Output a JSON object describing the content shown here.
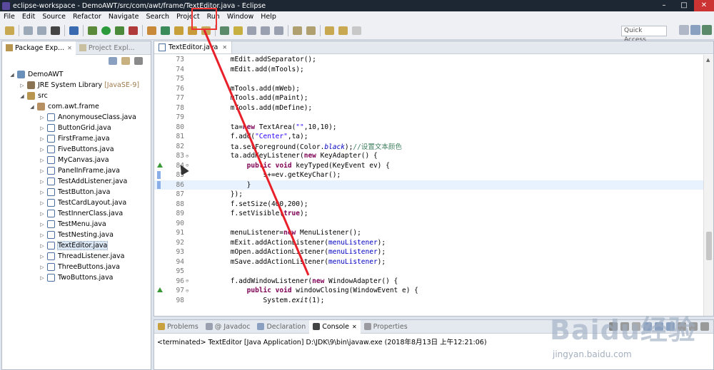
{
  "window": {
    "title": "eclipse-workspace - DemoAWT/src/com/awt/frame/TextEditor.java - Eclipse"
  },
  "menu": [
    "File",
    "Edit",
    "Source",
    "Refactor",
    "Navigate",
    "Search",
    "Project",
    "Run",
    "Window",
    "Help"
  ],
  "toolbar": {
    "quick_access": "Quick Access"
  },
  "left_panel": {
    "tabs": [
      {
        "label": "Package Exp...",
        "active": true
      },
      {
        "label": "Project Expl...",
        "active": false
      }
    ],
    "tree": [
      {
        "label": "DemoAWT",
        "level": 0,
        "expanded": true,
        "icon": "project-icon"
      },
      {
        "label": "JRE System Library",
        "version": "[JavaSE-9]",
        "level": 1,
        "expanded": false,
        "icon": "library-icon"
      },
      {
        "label": "src",
        "level": 1,
        "expanded": true,
        "icon": "source-folder-icon"
      },
      {
        "label": "com.awt.frame",
        "level": 2,
        "expanded": true,
        "icon": "package-icon"
      },
      {
        "label": "AnonymouseClass.java",
        "level": 3,
        "icon": "java-file-icon"
      },
      {
        "label": "ButtonGrid.java",
        "level": 3,
        "icon": "java-file-icon"
      },
      {
        "label": "FirstFrame.java",
        "level": 3,
        "icon": "java-file-icon"
      },
      {
        "label": "FiveButtons.java",
        "level": 3,
        "icon": "java-file-icon"
      },
      {
        "label": "MyCanvas.java",
        "level": 3,
        "icon": "java-file-icon"
      },
      {
        "label": "PanelInFrame.java",
        "level": 3,
        "icon": "java-file-icon"
      },
      {
        "label": "TestAddListener.java",
        "level": 3,
        "icon": "java-file-icon"
      },
      {
        "label": "TestButton.java",
        "level": 3,
        "icon": "java-file-icon"
      },
      {
        "label": "TestCardLayout.java",
        "level": 3,
        "icon": "java-file-icon"
      },
      {
        "label": "TestInnerClass.java",
        "level": 3,
        "icon": "java-file-icon"
      },
      {
        "label": "TestMenu.java",
        "level": 3,
        "icon": "java-file-icon"
      },
      {
        "label": "TestNesting.java",
        "level": 3,
        "icon": "java-file-icon"
      },
      {
        "label": "TextEditor.java",
        "level": 3,
        "icon": "java-file-icon",
        "selected": true
      },
      {
        "label": "ThreadListener.java",
        "level": 3,
        "icon": "java-file-icon"
      },
      {
        "label": "ThreeButtons.java",
        "level": 3,
        "icon": "java-file-icon"
      },
      {
        "label": "TwoButtons.java",
        "level": 3,
        "icon": "java-file-icon"
      }
    ]
  },
  "editor": {
    "tab_label": "TextEditor.java",
    "lines": [
      {
        "n": "73",
        "html": "        mEdit.addSeparator();"
      },
      {
        "n": "74",
        "html": "        mEdit.add(mTools);"
      },
      {
        "n": "75",
        "html": ""
      },
      {
        "n": "76",
        "html": "        mTools.add(mWeb);"
      },
      {
        "n": "77",
        "html": "        mTools.add(mPaint);"
      },
      {
        "n": "78",
        "html": "        mTools.add(mDefine);"
      },
      {
        "n": "79",
        "html": ""
      },
      {
        "n": "80",
        "html": "        ta=<span class=\"kw\">new</span> TextArea(<span class=\"str\">\"\"</span>,10,10);"
      },
      {
        "n": "81",
        "html": "        f.add(<span class=\"str\">\"Center\"</span>,ta);"
      },
      {
        "n": "82",
        "html": "        ta.setForeground(Color.<span class=\"fld it\">black</span>);<span class=\"cm\">//设置文本颜色</span>"
      },
      {
        "n": "83",
        "html": "        ta.addKeyListener(<span class=\"kw\">new</span> KeyAdapter() {",
        "fold": "⊖"
      },
      {
        "n": "84",
        "html": "            <span class=\"kw\">public void</span> keyTyped(KeyEvent ev) {",
        "fold": "⊖",
        "marker": "override"
      },
      {
        "n": "85",
        "html": "                s+=ev.getKeyChar();",
        "marker": "change"
      },
      {
        "n": "86",
        "html": "            }",
        "marker": "change",
        "current": true
      },
      {
        "n": "87",
        "html": "        });"
      },
      {
        "n": "88",
        "html": "        f.setSize(400,200);"
      },
      {
        "n": "89",
        "html": "        f.setVisible(<span class=\"kw\">true</span>);"
      },
      {
        "n": "90",
        "html": ""
      },
      {
        "n": "91",
        "html": "        menuListener=<span class=\"kw\">new</span> MenuListener();"
      },
      {
        "n": "92",
        "html": "        mExit.addActionListener(<span class=\"fld\">menuListener</span>);"
      },
      {
        "n": "93",
        "html": "        mOpen.addActionListener(<span class=\"fld\">menuListener</span>);"
      },
      {
        "n": "94",
        "html": "        mSave.addActionListener(<span class=\"fld\">menuListener</span>);"
      },
      {
        "n": "95",
        "html": ""
      },
      {
        "n": "96",
        "html": "        f.addWindowListener(<span class=\"kw\">new</span> WindowAdapter() {",
        "fold": "⊖"
      },
      {
        "n": "97",
        "html": "            <span class=\"kw\">public void</span> windowClosing(WindowEvent e) {",
        "fold": "⊖",
        "marker": "override"
      },
      {
        "n": "98",
        "html": "                System.<span class=\"it\">exit</span>(1);"
      }
    ]
  },
  "bottom_panel": {
    "tabs": [
      {
        "label": "Problems",
        "active": false,
        "icon": "problems-icon"
      },
      {
        "label": "@ Javadoc",
        "active": false,
        "icon": "javadoc-icon"
      },
      {
        "label": "Declaration",
        "active": false,
        "icon": "declaration-icon"
      },
      {
        "label": "Console",
        "active": true,
        "icon": "console-icon"
      },
      {
        "label": "Properties",
        "active": false,
        "icon": "properties-icon"
      }
    ],
    "console_text": "<terminated> TextEditor [Java Application] D:\\JDK\\9\\bin\\javaw.exe (2018年8月13日 上午12:21:06)"
  },
  "watermark": {
    "brand": "Baidu经验",
    "url": "jingyan.baidu.com"
  },
  "colors": {
    "title_bg": "#1d2733",
    "annotation_red": "#e33",
    "keyword": "#7f0055",
    "string": "#2a00ff",
    "comment": "#3f7f5f"
  }
}
